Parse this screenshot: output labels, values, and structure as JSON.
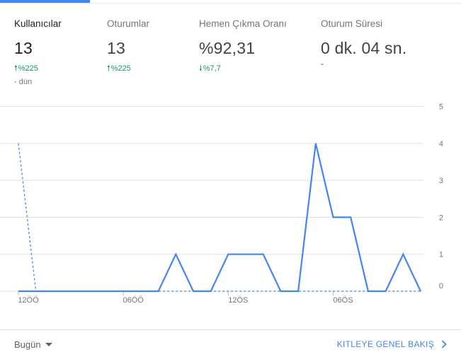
{
  "metrics": [
    {
      "label": "Kullanıcılar",
      "value": "13",
      "change": "%225",
      "change_direction": "up",
      "subnote": "- dün",
      "active": true
    },
    {
      "label": "Oturumlar",
      "value": "13",
      "change": "%225",
      "change_direction": "up"
    },
    {
      "label": "Hemen Çıkma Oranı",
      "value": "%92,31",
      "change": "%7,7",
      "change_direction": "down"
    },
    {
      "label": "Oturum Süresi",
      "value": "0 dk. 04 sn.",
      "change": "-"
    }
  ],
  "footer": {
    "date_range": "Bugün",
    "overview_link": "KITLEYE GENEL BAKIŞ"
  },
  "colors": {
    "accent": "#4285f4",
    "positive": "#0f9d58",
    "grid": "#e0e0e0"
  },
  "chart_data": {
    "type": "line",
    "x_tick_labels": [
      "12ÖÖ",
      "06ÖÖ",
      "12ÖS",
      "06ÖS"
    ],
    "y_ticks": [
      0,
      1,
      2,
      3,
      4,
      5
    ],
    "ylim": [
      0,
      5
    ],
    "grid": true,
    "series": [
      {
        "style": "solid",
        "values": [
          0,
          0,
          0,
          0,
          0,
          0,
          0,
          0,
          0,
          1,
          0,
          0,
          1,
          1,
          1,
          0,
          0,
          4,
          2,
          2,
          0,
          0,
          1,
          0
        ]
      },
      {
        "style": "dashed",
        "values": [
          4,
          0,
          0,
          0,
          0,
          0,
          0,
          0,
          0,
          0,
          0,
          0,
          0,
          0,
          0,
          0,
          0,
          0,
          0,
          0,
          0,
          0,
          0,
          0
        ]
      }
    ]
  }
}
